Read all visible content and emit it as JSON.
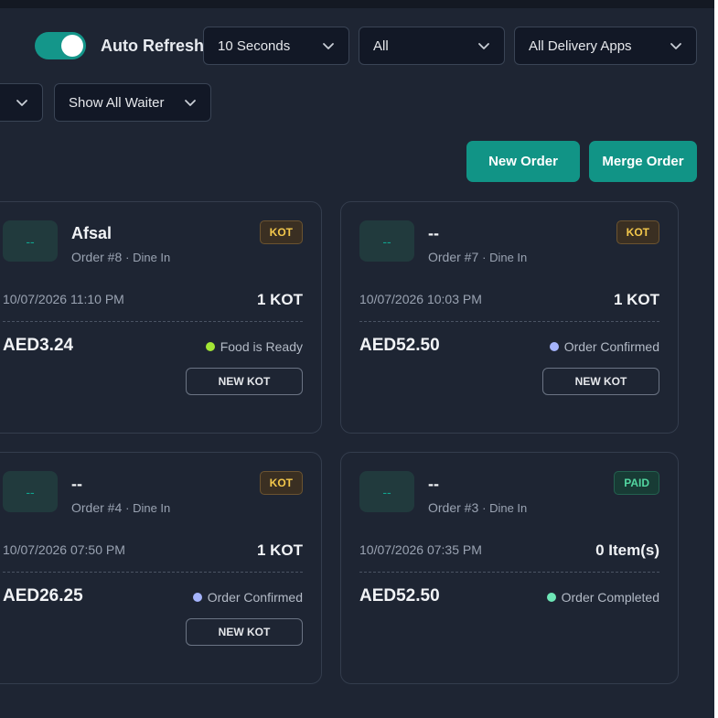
{
  "header": {
    "auto_refresh_label": "Auto Refresh",
    "auto_refresh_on": true,
    "refresh_interval": "10 Seconds",
    "order_filter": "All",
    "delivery_filter": "All Delivery Apps",
    "waiter_filter": "Show All Waiter"
  },
  "actions": {
    "new_order": "New Order",
    "merge_order": "Merge Order"
  },
  "colors": {
    "accent": "#119486",
    "food_ready": "#a3e635",
    "order_confirmed": "#a5b4fc",
    "order_completed": "#6ee7b7"
  },
  "orders": [
    {
      "avatar": "--",
      "customer": "Afsal",
      "order": "Order #8",
      "type": "· Dine In",
      "badge": "KOT",
      "datetime": "10/07/2026 11:10 PM",
      "count": "1 KOT",
      "amount": "AED3.24",
      "status": "Food is Ready",
      "action": "NEW KOT"
    },
    {
      "avatar": "--",
      "customer": "--",
      "order": "Order #7",
      "type": "· Dine In",
      "badge": "KOT",
      "datetime": "10/07/2026 10:03 PM",
      "count": "1 KOT",
      "amount": "AED52.50",
      "status": "Order Confirmed",
      "action": "NEW KOT"
    },
    {
      "avatar": "--",
      "customer": "--",
      "order": "Order #4",
      "type": "· Dine In",
      "badge": "KOT",
      "datetime": "10/07/2026 07:50 PM",
      "count": "1 KOT",
      "amount": "AED26.25",
      "status": "Order Confirmed",
      "action": "NEW KOT"
    },
    {
      "avatar": "--",
      "customer": "--",
      "order": "Order #3",
      "type": "· Dine In",
      "badge": "PAID",
      "datetime": "10/07/2026 07:35 PM",
      "count": "0 Item(s)",
      "amount": "AED52.50",
      "status": "Order Completed"
    }
  ]
}
